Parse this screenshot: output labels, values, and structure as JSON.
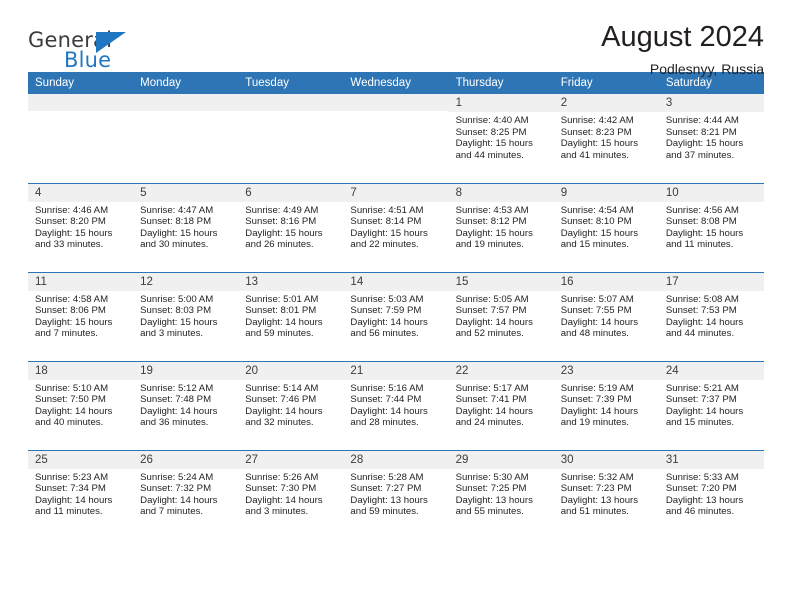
{
  "logo": {
    "word_top": "General",
    "word_bottom": "Blue",
    "accent_color": "#1f77c2"
  },
  "header": {
    "title": "August 2024",
    "subtitle": "Podlesnyy, Russia"
  },
  "calendar": {
    "header_bg": "#2e75b6",
    "daynum_bg": "#f0f0f0",
    "weekday_headers": [
      "Sunday",
      "Monday",
      "Tuesday",
      "Wednesday",
      "Thursday",
      "Friday",
      "Saturday"
    ],
    "weeks": [
      [
        {
          "day": "",
          "sunrise": "",
          "sunset": "",
          "daylight_line1": "",
          "daylight_line2": ""
        },
        {
          "day": "",
          "sunrise": "",
          "sunset": "",
          "daylight_line1": "",
          "daylight_line2": ""
        },
        {
          "day": "",
          "sunrise": "",
          "sunset": "",
          "daylight_line1": "",
          "daylight_line2": ""
        },
        {
          "day": "",
          "sunrise": "",
          "sunset": "",
          "daylight_line1": "",
          "daylight_line2": ""
        },
        {
          "day": "1",
          "sunrise": "Sunrise: 4:40 AM",
          "sunset": "Sunset: 8:25 PM",
          "daylight_line1": "Daylight: 15 hours",
          "daylight_line2": "and 44 minutes."
        },
        {
          "day": "2",
          "sunrise": "Sunrise: 4:42 AM",
          "sunset": "Sunset: 8:23 PM",
          "daylight_line1": "Daylight: 15 hours",
          "daylight_line2": "and 41 minutes."
        },
        {
          "day": "3",
          "sunrise": "Sunrise: 4:44 AM",
          "sunset": "Sunset: 8:21 PM",
          "daylight_line1": "Daylight: 15 hours",
          "daylight_line2": "and 37 minutes."
        }
      ],
      [
        {
          "day": "4",
          "sunrise": "Sunrise: 4:46 AM",
          "sunset": "Sunset: 8:20 PM",
          "daylight_line1": "Daylight: 15 hours",
          "daylight_line2": "and 33 minutes."
        },
        {
          "day": "5",
          "sunrise": "Sunrise: 4:47 AM",
          "sunset": "Sunset: 8:18 PM",
          "daylight_line1": "Daylight: 15 hours",
          "daylight_line2": "and 30 minutes."
        },
        {
          "day": "6",
          "sunrise": "Sunrise: 4:49 AM",
          "sunset": "Sunset: 8:16 PM",
          "daylight_line1": "Daylight: 15 hours",
          "daylight_line2": "and 26 minutes."
        },
        {
          "day": "7",
          "sunrise": "Sunrise: 4:51 AM",
          "sunset": "Sunset: 8:14 PM",
          "daylight_line1": "Daylight: 15 hours",
          "daylight_line2": "and 22 minutes."
        },
        {
          "day": "8",
          "sunrise": "Sunrise: 4:53 AM",
          "sunset": "Sunset: 8:12 PM",
          "daylight_line1": "Daylight: 15 hours",
          "daylight_line2": "and 19 minutes."
        },
        {
          "day": "9",
          "sunrise": "Sunrise: 4:54 AM",
          "sunset": "Sunset: 8:10 PM",
          "daylight_line1": "Daylight: 15 hours",
          "daylight_line2": "and 15 minutes."
        },
        {
          "day": "10",
          "sunrise": "Sunrise: 4:56 AM",
          "sunset": "Sunset: 8:08 PM",
          "daylight_line1": "Daylight: 15 hours",
          "daylight_line2": "and 11 minutes."
        }
      ],
      [
        {
          "day": "11",
          "sunrise": "Sunrise: 4:58 AM",
          "sunset": "Sunset: 8:06 PM",
          "daylight_line1": "Daylight: 15 hours",
          "daylight_line2": "and 7 minutes."
        },
        {
          "day": "12",
          "sunrise": "Sunrise: 5:00 AM",
          "sunset": "Sunset: 8:03 PM",
          "daylight_line1": "Daylight: 15 hours",
          "daylight_line2": "and 3 minutes."
        },
        {
          "day": "13",
          "sunrise": "Sunrise: 5:01 AM",
          "sunset": "Sunset: 8:01 PM",
          "daylight_line1": "Daylight: 14 hours",
          "daylight_line2": "and 59 minutes."
        },
        {
          "day": "14",
          "sunrise": "Sunrise: 5:03 AM",
          "sunset": "Sunset: 7:59 PM",
          "daylight_line1": "Daylight: 14 hours",
          "daylight_line2": "and 56 minutes."
        },
        {
          "day": "15",
          "sunrise": "Sunrise: 5:05 AM",
          "sunset": "Sunset: 7:57 PM",
          "daylight_line1": "Daylight: 14 hours",
          "daylight_line2": "and 52 minutes."
        },
        {
          "day": "16",
          "sunrise": "Sunrise: 5:07 AM",
          "sunset": "Sunset: 7:55 PM",
          "daylight_line1": "Daylight: 14 hours",
          "daylight_line2": "and 48 minutes."
        },
        {
          "day": "17",
          "sunrise": "Sunrise: 5:08 AM",
          "sunset": "Sunset: 7:53 PM",
          "daylight_line1": "Daylight: 14 hours",
          "daylight_line2": "and 44 minutes."
        }
      ],
      [
        {
          "day": "18",
          "sunrise": "Sunrise: 5:10 AM",
          "sunset": "Sunset: 7:50 PM",
          "daylight_line1": "Daylight: 14 hours",
          "daylight_line2": "and 40 minutes."
        },
        {
          "day": "19",
          "sunrise": "Sunrise: 5:12 AM",
          "sunset": "Sunset: 7:48 PM",
          "daylight_line1": "Daylight: 14 hours",
          "daylight_line2": "and 36 minutes."
        },
        {
          "day": "20",
          "sunrise": "Sunrise: 5:14 AM",
          "sunset": "Sunset: 7:46 PM",
          "daylight_line1": "Daylight: 14 hours",
          "daylight_line2": "and 32 minutes."
        },
        {
          "day": "21",
          "sunrise": "Sunrise: 5:16 AM",
          "sunset": "Sunset: 7:44 PM",
          "daylight_line1": "Daylight: 14 hours",
          "daylight_line2": "and 28 minutes."
        },
        {
          "day": "22",
          "sunrise": "Sunrise: 5:17 AM",
          "sunset": "Sunset: 7:41 PM",
          "daylight_line1": "Daylight: 14 hours",
          "daylight_line2": "and 24 minutes."
        },
        {
          "day": "23",
          "sunrise": "Sunrise: 5:19 AM",
          "sunset": "Sunset: 7:39 PM",
          "daylight_line1": "Daylight: 14 hours",
          "daylight_line2": "and 19 minutes."
        },
        {
          "day": "24",
          "sunrise": "Sunrise: 5:21 AM",
          "sunset": "Sunset: 7:37 PM",
          "daylight_line1": "Daylight: 14 hours",
          "daylight_line2": "and 15 minutes."
        }
      ],
      [
        {
          "day": "25",
          "sunrise": "Sunrise: 5:23 AM",
          "sunset": "Sunset: 7:34 PM",
          "daylight_line1": "Daylight: 14 hours",
          "daylight_line2": "and 11 minutes."
        },
        {
          "day": "26",
          "sunrise": "Sunrise: 5:24 AM",
          "sunset": "Sunset: 7:32 PM",
          "daylight_line1": "Daylight: 14 hours",
          "daylight_line2": "and 7 minutes."
        },
        {
          "day": "27",
          "sunrise": "Sunrise: 5:26 AM",
          "sunset": "Sunset: 7:30 PM",
          "daylight_line1": "Daylight: 14 hours",
          "daylight_line2": "and 3 minutes."
        },
        {
          "day": "28",
          "sunrise": "Sunrise: 5:28 AM",
          "sunset": "Sunset: 7:27 PM",
          "daylight_line1": "Daylight: 13 hours",
          "daylight_line2": "and 59 minutes."
        },
        {
          "day": "29",
          "sunrise": "Sunrise: 5:30 AM",
          "sunset": "Sunset: 7:25 PM",
          "daylight_line1": "Daylight: 13 hours",
          "daylight_line2": "and 55 minutes."
        },
        {
          "day": "30",
          "sunrise": "Sunrise: 5:32 AM",
          "sunset": "Sunset: 7:23 PM",
          "daylight_line1": "Daylight: 13 hours",
          "daylight_line2": "and 51 minutes."
        },
        {
          "day": "31",
          "sunrise": "Sunrise: 5:33 AM",
          "sunset": "Sunset: 7:20 PM",
          "daylight_line1": "Daylight: 13 hours",
          "daylight_line2": "and 46 minutes."
        }
      ]
    ]
  }
}
